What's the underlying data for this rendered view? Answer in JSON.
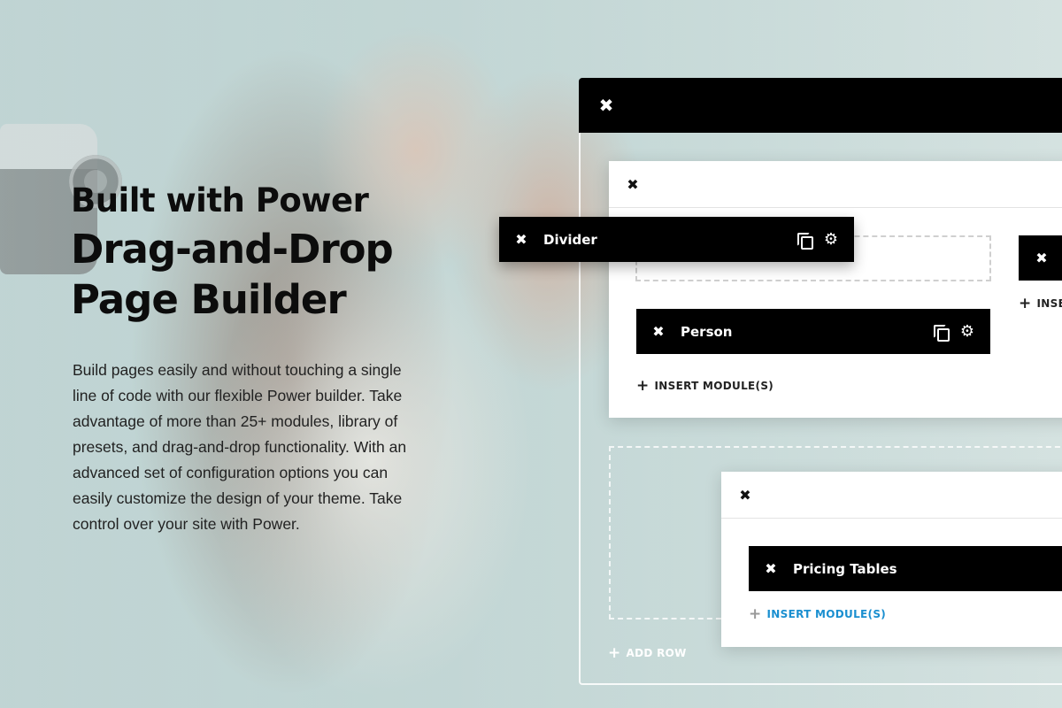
{
  "hero": {
    "title_small": "Built with Power",
    "title_big_line1": "Drag-and-Drop",
    "title_big_line2": "Page Builder",
    "description": "Build pages easily and without touching a single line of code with our flexible Power builder. Take advantage of more than 25+ modules, library of presets, and drag-and-drop functionality. With an advanced set of configuration options you can easily customize the design of your theme. Take control over your site with Power."
  },
  "builder": {
    "close_icon": "✖",
    "modules": {
      "divider": "Divider",
      "person": "Person",
      "pricing": "Pricing Tables"
    },
    "insert_label": "INSERT MODULE(S)",
    "insert_partial": "INSE",
    "add_row_label": "ADD ROW",
    "accent_color": "#1a8fd0"
  },
  "icons": {
    "close": "close-icon",
    "duplicate": "duplicate-icon",
    "settings": "gear-icon",
    "add": "plus-icon"
  }
}
